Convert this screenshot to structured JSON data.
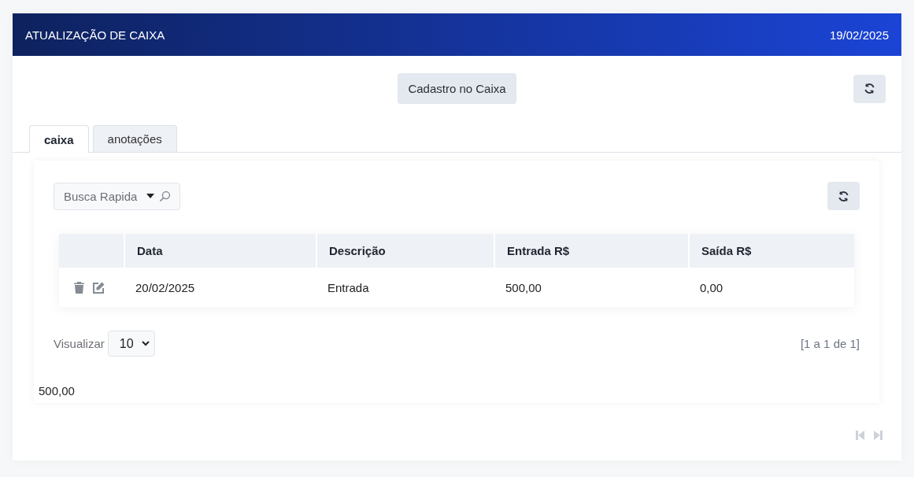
{
  "header": {
    "title": "ATUALIZAÇÃO DE CAIXA",
    "date": "19/02/2025"
  },
  "toolbar": {
    "button": "Cadastro no Caixa"
  },
  "tabs": [
    {
      "label": "caixa",
      "selected": true
    },
    {
      "label": "anotações",
      "selected": false
    }
  ],
  "search": {
    "placeholder": "Busca Rapida"
  },
  "table": {
    "columns": [
      "Data",
      "Descrição",
      "Entrada R$",
      "Saída R$"
    ],
    "rows": [
      {
        "cells": [
          "20/02/2025",
          "Entrada",
          "500,00",
          "0,00"
        ]
      }
    ]
  },
  "pager": {
    "label": "Visualizar",
    "page_size": "10",
    "range": "[1 a 1 de 1]"
  },
  "total": "500,00"
}
